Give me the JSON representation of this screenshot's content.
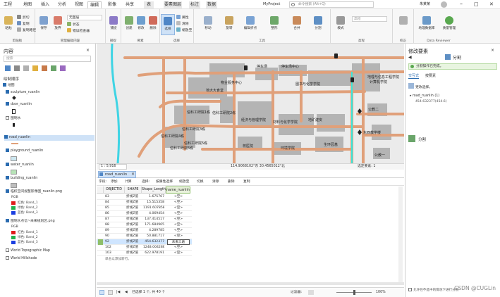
{
  "window": {
    "title": "MyProject",
    "user": "朱某某"
  },
  "tabs": [
    {
      "label": "工程"
    },
    {
      "label": "地图"
    },
    {
      "label": "插入"
    },
    {
      "label": "分析"
    },
    {
      "label": "视图"
    },
    {
      "label": "编辑"
    },
    {
      "label": "影像"
    },
    {
      "label": "共享"
    },
    {
      "label": "表"
    },
    {
      "label": "要素图层"
    },
    {
      "label": "标注"
    },
    {
      "label": "数据"
    }
  ],
  "search": {
    "placeholder": "命令搜索 (Alt+Q)"
  },
  "ribbon": {
    "clipboard": {
      "label": "剪贴板",
      "paste": "粘贴",
      "cut": "剪切",
      "copy": "复制",
      "copy_path": "复制路径"
    },
    "manage": {
      "label": "管理编辑内容",
      "save": "保存",
      "discard": "放弃",
      "layer_select": "无图层",
      "attribute": "状态",
      "edit_tasks": "错误检查器"
    },
    "snapping": {
      "label": "捕捉",
      "btn": "捕捉"
    },
    "features": {
      "label": "要素",
      "create": "创建",
      "modify": "修改",
      "delete": "删除"
    },
    "selection": {
      "label": "选择",
      "select": "选择",
      "attributes": "属性",
      "clear": "清除",
      "zoom": "缩放至"
    },
    "tools": {
      "label": "工具",
      "items": [
        "移动",
        "旋转",
        "编辑折点",
        "整形",
        "合并",
        "分割"
      ]
    },
    "elevation": {
      "label": "高程",
      "mode": "模式",
      "value": "高程"
    },
    "corrections": {
      "label": "校正"
    },
    "data_reviewer": {
      "label": "Data Reviewer",
      "geodb": "地理数据库",
      "manage": "质量管理"
    }
  },
  "contents": {
    "title": "内容",
    "search_placeholder": "搜索",
    "section": "绘制顺序",
    "layers": [
      {
        "name": "地图",
        "on": true
      },
      {
        "name": "sculpture_ruanlin",
        "on": true
      },
      {
        "name": "door_ruanlin",
        "on": true
      },
      {
        "name": "图制水",
        "on": false
      },
      {
        "name": "road_ruanlin",
        "on": true
      },
      {
        "name": "playground_ruanlin",
        "on": true
      },
      {
        "name": "water_ruanlin",
        "on": true
      },
      {
        "name": "building_ruanlin",
        "on": true
      },
      {
        "name": "临校空间规整影像图_ruanlin.png",
        "on": true
      },
      {
        "name": "图制水点信~未来规划区.png",
        "on": true
      },
      {
        "name": "World Topographic Map",
        "on": false
      },
      {
        "name": "World Hillshade",
        "on": false
      }
    ],
    "bands1": [
      "红色:  Band_1",
      "绿色:  Band_2",
      "蓝色:  Band_3"
    ],
    "bands2": [
      "红色:  Band_1",
      "绿色:  Band_2",
      "蓝色:  Band_3"
    ],
    "band_group": "RGB"
  },
  "map": {
    "labels": [
      "停车场",
      "停车场中心",
      "物业服务中心",
      "图书与化学学院",
      "地理与信息工程学院",
      "计算机学院",
      "地大大食堂",
      "信科工研院1栋",
      "信科工研院2栋",
      "经济与管理学院",
      "材料与化学学院",
      "地矿建安",
      "公教二",
      "东西教学楼",
      "信科工研院3栋",
      "信科工研院4栋",
      "信科工研院5栋",
      "信科工研院6栋",
      "校医院",
      "环境学院",
      "生环园基",
      "公教一"
    ],
    "scale": "1 : 5,916",
    "coords": "114.9068102°东  30.4565012°北",
    "selection": "选定要素: 1"
  },
  "attribute_table": {
    "tab": "road_ruanlin",
    "tabs_close": "×",
    "toolbar": [
      "字段:",
      "添加",
      "计算",
      "选择:",
      "按属性选择",
      "缩放至",
      "切换",
      "清除",
      "删除",
      "复制"
    ],
    "columns": [
      "OBJECTID",
      "SHAPE",
      "Shape_Length",
      "name_ruanlin"
    ],
    "rows": [
      [
        "83",
        "折线Z值",
        "1.675767",
        "<空>"
      ],
      [
        "84",
        "折线Z值",
        "15.515358",
        "<空>"
      ],
      [
        "85",
        "折线Z值",
        "1191.607858",
        "<空>"
      ],
      [
        "86",
        "折线Z值",
        "4.069454",
        "<空>"
      ],
      [
        "87",
        "折线Z值",
        "137.414517",
        "<空>"
      ],
      [
        "88",
        "折线Z值",
        "171.684965",
        "<空>"
      ],
      [
        "89",
        "折线Z值",
        "4.289785",
        "<空>"
      ],
      [
        "90",
        "折线Z值",
        "50.881717",
        "<空>"
      ],
      [
        "92",
        "折线Z值",
        "454.632377",
        "未来三路"
      ],
      [
        "102",
        "折线Z值",
        "1248.004286",
        "<空>"
      ],
      [
        "103",
        "折线Z值",
        "622.978191",
        "<空>"
      ]
    ],
    "add_row_hint": "单击以添加新行。",
    "selected_info": "已选择 1 个, 共 40 个",
    "filter_label": "过滤器:",
    "zoom": "100%"
  },
  "modify": {
    "title": "修改要素",
    "tool": "分割",
    "notice": "分割操作已完成。",
    "tabs": [
      "交互式",
      "按要素"
    ],
    "check_label": "更改选择。",
    "tree_item": "road_ruanlin (1)",
    "tree_sub": "454.632377(454.6)",
    "bottom_tool": "分割",
    "bottom_check": "允许在不选中的情况下进行分割"
  },
  "watermark": "CSDN @CUGLin",
  "colors": {
    "road": "#e0a07a",
    "building": "#b4b4b4",
    "water": "#3fd4e4",
    "accent": "#2b6cb0",
    "select_row": "#cfe5ff"
  }
}
